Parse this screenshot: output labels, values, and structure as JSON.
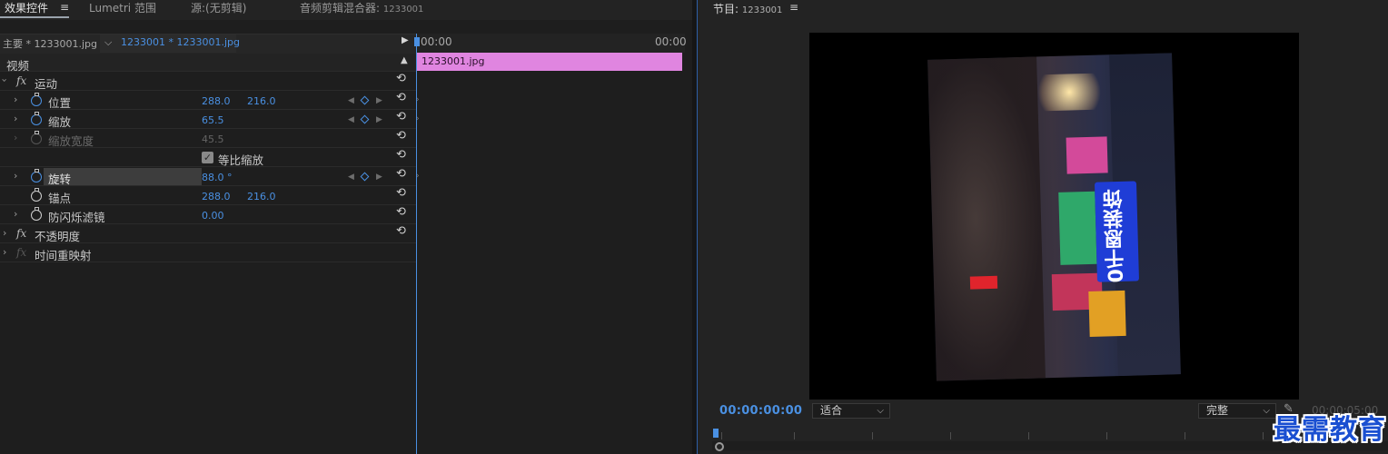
{
  "tabs": [
    {
      "label": "效果控件",
      "active": true
    },
    {
      "label": "Lumetri 范围",
      "active": false
    },
    {
      "label": "源:(无剪辑)",
      "active": false
    },
    {
      "label": "音频剪辑混合器:",
      "sub": "1233001",
      "active": false
    }
  ],
  "menu_glyph": "≡",
  "clip_header": {
    "master": "主要 * 1233001.jpg",
    "sequence": "1233001 * 1233001.jpg"
  },
  "timeline": {
    "start_time": "00:00",
    "end_time": "00:00",
    "clip_label": "1233001.jpg",
    "clip_color": "#e085e0"
  },
  "effects": {
    "video_header": "视频",
    "motion": {
      "label": "运动",
      "position": {
        "label": "位置",
        "x": "288.0",
        "y": "216.0"
      },
      "scale": {
        "label": "缩放",
        "value": "65.5"
      },
      "scale_width": {
        "label": "缩放宽度",
        "value": "45.5"
      },
      "uniform_scale": {
        "label": "等比缩放",
        "checked": true
      },
      "rotation": {
        "label": "旋转",
        "value": "88.0 °"
      },
      "anchor": {
        "label": "锚点",
        "x": "288.0",
        "y": "216.0"
      },
      "anti_flicker": {
        "label": "防闪烁滤镜",
        "value": "0.00"
      }
    },
    "opacity": {
      "label": "不透明度"
    },
    "time_remap": {
      "label": "时间重映射"
    }
  },
  "program": {
    "title": "节目:",
    "sequence": "1233001",
    "timecode": "00:00:00:00",
    "fit": "适合",
    "quality": "完整",
    "duration": "00:00:05:00",
    "sign_text": "0千恩装饰"
  },
  "watermark": "最需教育",
  "colors": {
    "accent_blue": "#4a90e2",
    "clip_pink": "#e085e0",
    "watermark_blue": "#1a4fd1"
  }
}
